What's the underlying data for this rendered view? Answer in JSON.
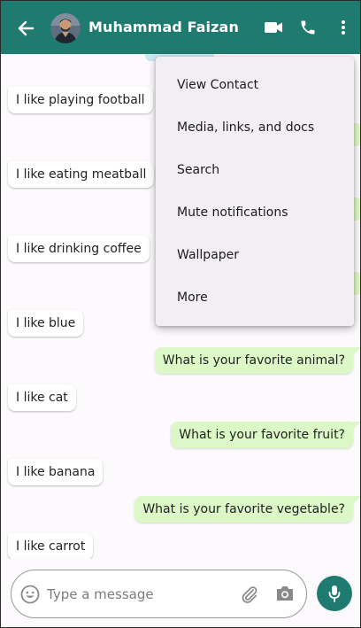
{
  "header": {
    "contact_name": "Muhammad Faizan"
  },
  "messages": [
    {
      "dir": "in",
      "text": "I like playing football"
    },
    {
      "dir": "in",
      "text": "I like eating meatball"
    },
    {
      "dir": "in",
      "text": "I like drinking coffee"
    },
    {
      "dir": "in",
      "text": "I like blue"
    },
    {
      "dir": "out",
      "text": "What is your favorite animal?"
    },
    {
      "dir": "in",
      "text": "I like cat"
    },
    {
      "dir": "out",
      "text": "What is your favorite fruit?"
    },
    {
      "dir": "in",
      "text": "I like banana"
    },
    {
      "dir": "out",
      "text": "What is your favorite vegetable?"
    },
    {
      "dir": "in",
      "text": "I like carrot"
    }
  ],
  "menu": {
    "items": [
      "View Contact",
      "Media, links, and docs",
      "Search",
      "Mute notifications",
      "Wallpaper",
      "More"
    ]
  },
  "composer": {
    "placeholder": "Type a message"
  },
  "colors": {
    "header": "#1f7a70",
    "outgoing_bubble": "#dcf8c6",
    "incoming_bubble": "#ffffff",
    "menu_background": "#f2eff4"
  }
}
